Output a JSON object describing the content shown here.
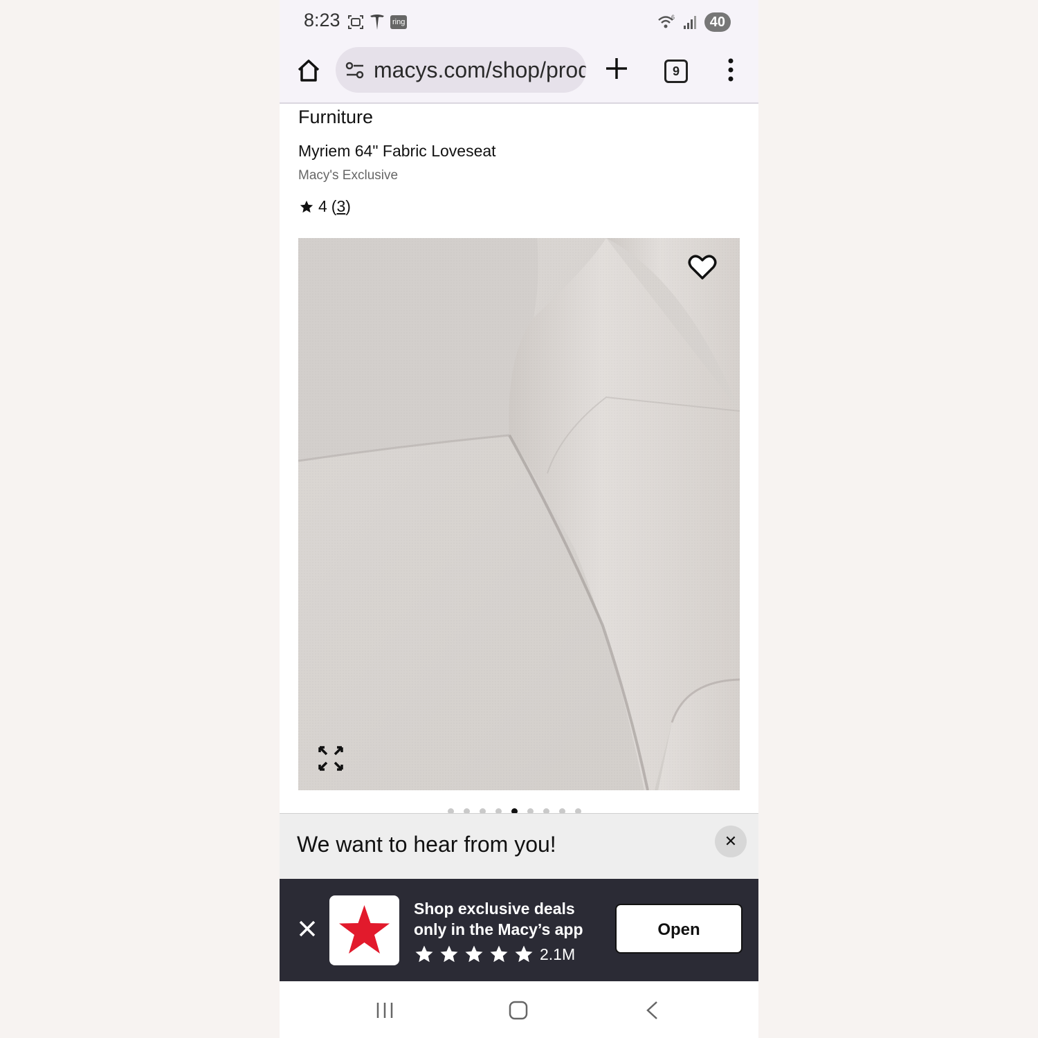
{
  "status_bar": {
    "time": "8:23",
    "ring_label": "ring",
    "battery": "40",
    "wifi_label": "6"
  },
  "browser": {
    "url": "macys.com/shop/prod",
    "tab_count": "9"
  },
  "product": {
    "category": "Furniture",
    "name": "Myriem 64\" Fabric Loveseat",
    "brand": "Macy's Exclusive",
    "rating": "4",
    "review_count": "3",
    "image_count": 9,
    "active_image_index": 4
  },
  "feedback": {
    "text": "We want to hear from you!",
    "close_label": "✕"
  },
  "app_banner": {
    "title": "Shop exclusive deals only in the Macy’s app",
    "rating_count": "2.1M",
    "stars": 5,
    "open_label": "Open"
  },
  "colors": {
    "macys_red": "#e21a2c",
    "banner_bg": "#2b2b35",
    "fabric": "#d9d5d2"
  }
}
